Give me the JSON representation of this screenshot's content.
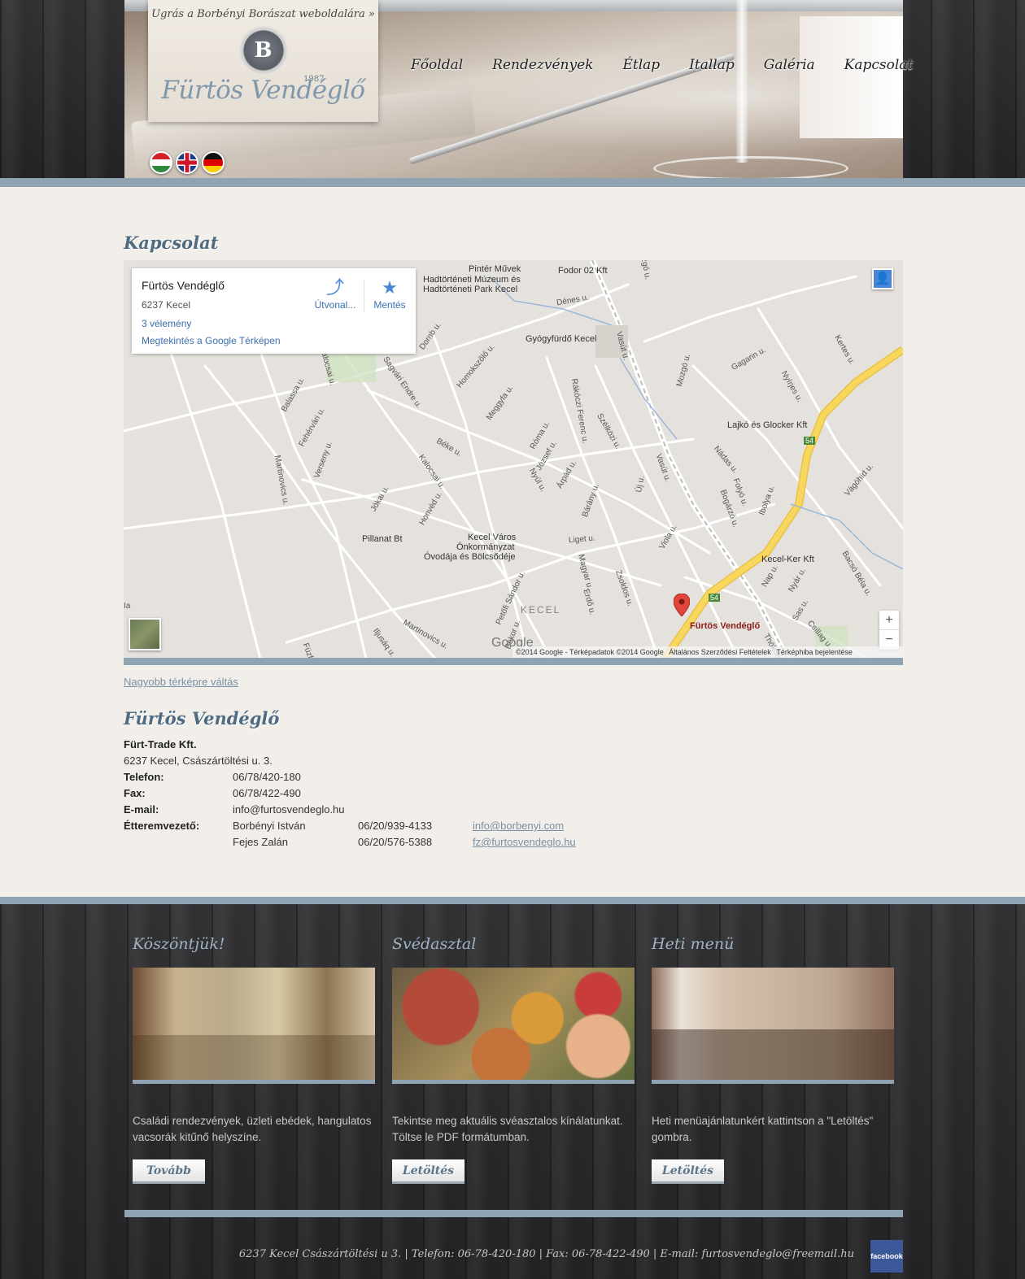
{
  "header": {
    "winery_link": "Ugrás a Borbényi Borászat weboldalára »",
    "logo_letter": "B",
    "logo_year": "1987",
    "logo_name": "Fürtös Vendéglő",
    "flags": [
      "hu",
      "en",
      "de"
    ],
    "nav": [
      "Főoldal",
      "Rendezvények",
      "Étlap",
      "Itallap",
      "Galéria",
      "Kapcsolat"
    ]
  },
  "page": {
    "title": "Kapcsolat",
    "map_switch": "Nagyobb térképre váltás"
  },
  "map": {
    "card": {
      "name": "Fürtös Vendéglő",
      "address": "6237 Kecel",
      "reviews": "3 vélemény",
      "view_link": "Megtekintés a Google Térképen",
      "route_label": "Útvonal...",
      "save_label": "Mentés"
    },
    "marker_label": "Fürtös Vendéglő",
    "town_label": "KECEL",
    "google_logo": "Google",
    "footer": {
      "copyright": "©2014 Google - Térképadatok ©2014 Google",
      "terms": "Általános Szerződési Feltételek",
      "report": "Térképhiba bejelentése"
    },
    "road_number": "54",
    "pois": [
      "Pintér Művek",
      "Fodor 02 Kft",
      "Hadtörténeti Múzeum és",
      "Hadtörténeti Park Kecel",
      "Gyógyfürdő Kecel",
      "Lajkó és Glocker Kft",
      "Pillanat Bt",
      "Kecel Város",
      "Önkormányzat",
      "Óvodája és Bölcsődéje",
      "Kecel-Ker Kft"
    ],
    "streets": [
      "Dénes u.",
      "Dornb u.",
      "Vasút u.",
      "Gagarin u.",
      "Kertes u.",
      "Kalocsai u.",
      "Sagvári Endre u.",
      "Homokszőlő u.",
      "Rákóczi Ferenc u.",
      "Mozgó u.",
      "Nyírjes u.",
      "Balassa u.",
      "Fehérvári u.",
      "Meggyfa u.",
      "Szélközi u.",
      "Vasút u.",
      "Béke u.",
      "Róma u.",
      "Nádas u.",
      "Martinovics u.",
      "Verseny u.",
      "József u.",
      "Vágóhíd u.",
      "Kalocsai u.",
      "Jókai u.",
      "Nyúl u.",
      "Árpád u.",
      "Új u.",
      "Folyó u.",
      "Ibolya u.",
      "Bogárzó u.",
      "Honvéd u.",
      "Bárány u.",
      "Liget u.",
      "Viola u.",
      "Magyar u.",
      "Zsoldos u.",
      "Erdő u.",
      "Nap u.",
      "Nyár u.",
      "Bacsó Béla u.",
      "Petőfi Sándor u.",
      "Martinovics u.",
      "Iljusáq u.",
      "Bokor u.",
      "Füzfás",
      "Sas u.",
      "Csillag u.",
      "Thököly",
      "Ia",
      "zgó u."
    ]
  },
  "info": {
    "title": "Fürtös Vendéglő",
    "company": "Fürt-Trade Kft.",
    "address": "6237 Kecel, Császártöltési u. 3.",
    "phone_label": "Telefon:",
    "phone": "06/78/420-180",
    "fax_label": "Fax:",
    "fax": "06/78/422-490",
    "email_label": "E-mail:",
    "email": "info@furtosvendeglo.hu",
    "managers_label": "Étteremvezető:",
    "managers": [
      {
        "name": "Borbényi István",
        "phone": "06/20/939-4133",
        "email": "info@borbenyi.com"
      },
      {
        "name": "Fejes Zalán",
        "phone": "06/20/576-5388",
        "email": "fz@furtosvendeglo.hu"
      }
    ]
  },
  "footer": {
    "columns": [
      {
        "title": "Köszöntjük!",
        "text": "Családi rendezvények, üzleti ebédek, hangulatos vacsorák kitűnő helyszíne.",
        "button": "Tovább"
      },
      {
        "title": "Svédasztal",
        "text": "Tekintse meg aktuális svéasztalos kínálatunkat. Töltse le PDF formátumban.",
        "button": "Letöltés"
      },
      {
        "title": "Heti menü",
        "text": "Heti menüajánlatunkért kattintson a \"Letöltés\" gombra.",
        "button": "Letöltés"
      }
    ],
    "contact_line": "6237 Kecel Császártöltési u 3. | Telefon: 06-78-420-180 | Fax: 06-78-422-490 | E-mail: furtosvendeglo@freemail.hu",
    "facebook": "facebook"
  }
}
